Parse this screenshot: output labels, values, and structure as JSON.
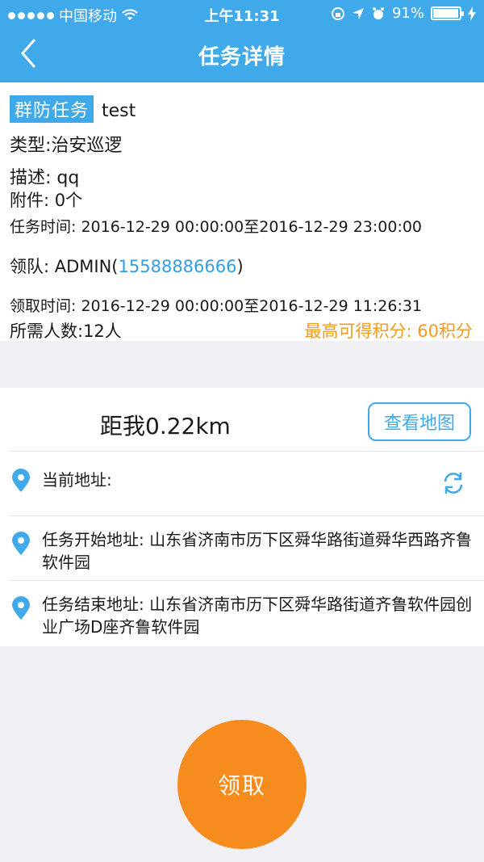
{
  "status_bar": {
    "carrier": "中国移动",
    "time": "上午11:31",
    "battery": "91%"
  },
  "nav": {
    "title": "任务详情"
  },
  "task": {
    "tag": "群防任务",
    "name": "test",
    "type": "类型:治安巡逻",
    "description": "描述: qq",
    "attachments": "附件: 0个",
    "task_time": "任务时间: 2016-12-29 00:00:00至2016-12-29 23:00:00",
    "leader_prefix": "领队: ADMIN(",
    "leader_phone": "15588886666",
    "leader_suffix": ")",
    "claim_time": "领取时间: 2016-12-29 00:00:00至2016-12-29 11:26:31",
    "people_needed": "所需人数:12人",
    "max_points": "最高可得积分: 60积分"
  },
  "location": {
    "distance": "距我0.22km",
    "map_button": "查看地图",
    "current_address": "当前地址:",
    "start_address": "任务开始地址: 山东省济南市历下区舜华路街道舜华西路齐鲁软件园",
    "end_address": "任务结束地址: 山东省济南市历下区舜华路街道齐鲁软件园创业广场D座齐鲁软件园"
  },
  "actions": {
    "claim": "领取"
  },
  "colors": {
    "primary": "#3fa9ea",
    "accent": "#f68b1e",
    "points": "#f29a21"
  }
}
